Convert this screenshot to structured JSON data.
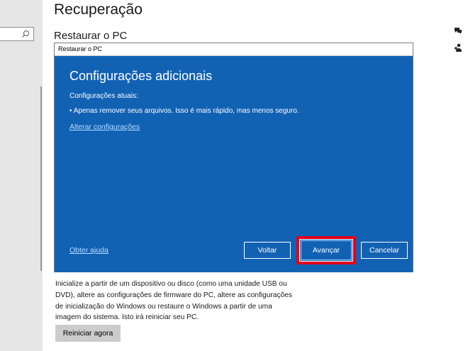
{
  "page": {
    "title": "Recuperação",
    "section_title": "Restaurar o PC"
  },
  "sidebar": {
    "search_icon": "search-icon"
  },
  "dialog": {
    "window_title": "Restaurar o PC",
    "heading": "Configurações adicionais",
    "current_settings_label": "Configurações atuais:",
    "current_settings_item": "• Apenas remover seus arquivos. Isso é mais rápido, mas menos seguro.",
    "change_settings_link": "Alterar configurações",
    "help_link": "Obter ajuda",
    "buttons": {
      "back": "Voltar",
      "next": "Avançar",
      "cancel": "Cancelar"
    },
    "highlight_color": "#e0001a",
    "background_color": "#1262b4"
  },
  "advanced_startup": {
    "description": "Inicialize a partir de um dispositivo ou disco (como uma unidade USB ou DVD), altere as configurações de firmware do PC, altere as configurações de inicialização do Windows ou restaure o Windows a partir de uma imagem do sistema. Isto irá reiniciar seu PC.",
    "restart_button": "Reiniciar agora"
  },
  "right_icons": [
    "chat-icon",
    "person-icon"
  ]
}
